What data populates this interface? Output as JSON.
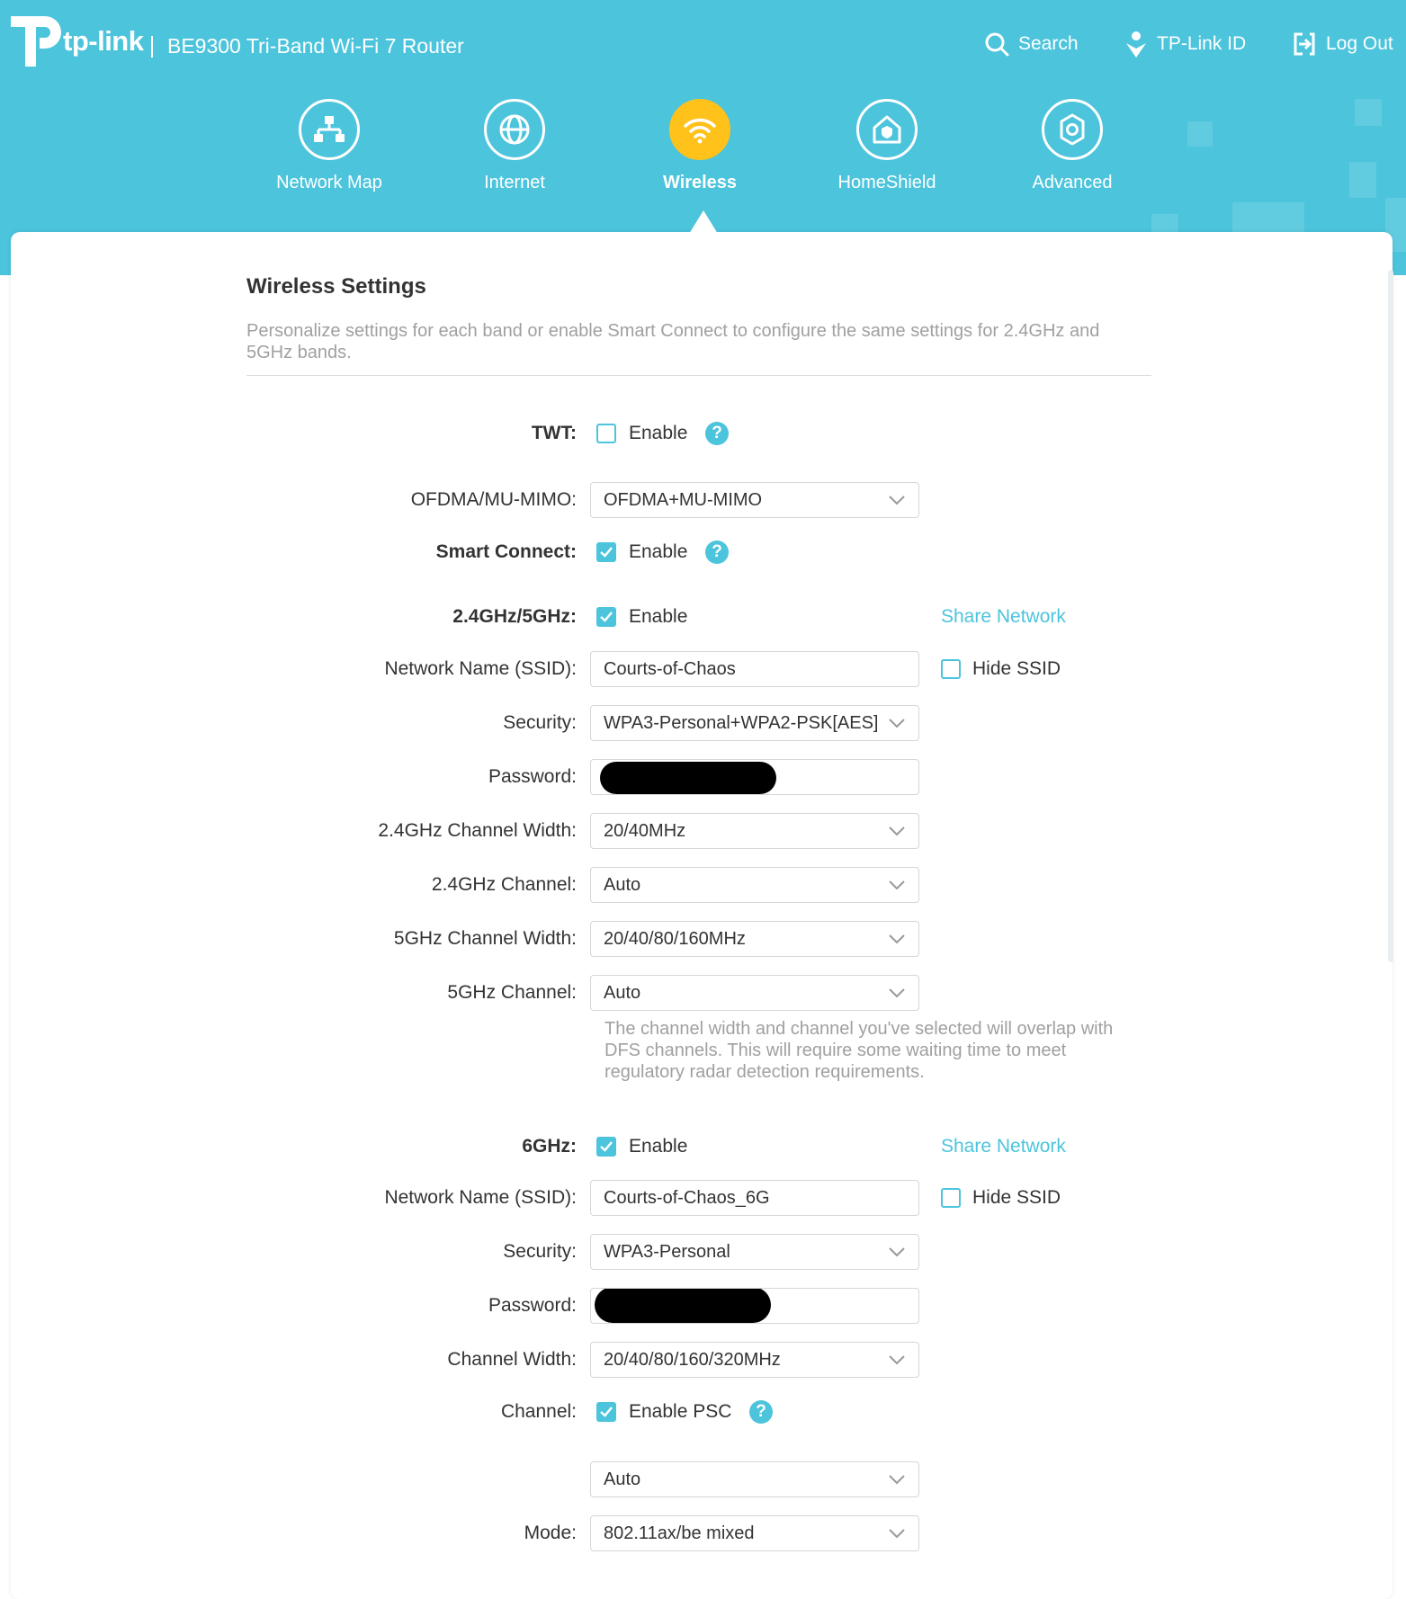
{
  "header": {
    "brand": "tp-link",
    "model": "BE9300 Tri-Band Wi-Fi 7 Router",
    "links": {
      "search": "Search",
      "tplink_id": "TP-Link ID",
      "logout": "Log Out"
    }
  },
  "nav": {
    "items": [
      {
        "label": "Network Map",
        "icon": "network-map-icon"
      },
      {
        "label": "Internet",
        "icon": "globe-icon"
      },
      {
        "label": "Wireless",
        "icon": "wifi-icon",
        "active": true
      },
      {
        "label": "HomeShield",
        "icon": "home-shield-icon"
      },
      {
        "label": "Advanced",
        "icon": "gear-icon"
      }
    ]
  },
  "section": {
    "title": "Wireless Settings",
    "description": "Personalize settings for each band or enable Smart Connect to configure the same settings for 2.4GHz and 5GHz bands."
  },
  "form": {
    "twt": {
      "label": "TWT:",
      "enable_label": "Enable",
      "checked": false
    },
    "ofdma": {
      "label": "OFDMA/MU-MIMO:",
      "value": "OFDMA+MU-MIMO"
    },
    "smart_connect": {
      "label": "Smart Connect:",
      "enable_label": "Enable",
      "checked": true
    },
    "band_24_5": {
      "label": "2.4GHz/5GHz:",
      "enable_label": "Enable",
      "checked": true,
      "share_network": "Share Network",
      "ssid_label": "Network Name (SSID):",
      "ssid": "Courts-of-Chaos",
      "hide_ssid": "Hide SSID",
      "security_label": "Security:",
      "security": "WPA3-Personal+WPA2-PSK[AES]",
      "password_label": "Password:",
      "ch_width_24_label": "2.4GHz Channel Width:",
      "ch_width_24": "20/40MHz",
      "channel_24_label": "2.4GHz Channel:",
      "channel_24": "Auto",
      "ch_width_5_label": "5GHz Channel Width:",
      "ch_width_5": "20/40/80/160MHz",
      "channel_5_label": "5GHz Channel:",
      "channel_5": "Auto",
      "dfs_note": "The channel width and channel you've selected will overlap with DFS channels. This will require some waiting time to meet regulatory radar detection requirements."
    },
    "band_6": {
      "label": "6GHz:",
      "enable_label": "Enable",
      "checked": true,
      "share_network": "Share Network",
      "ssid_label": "Network Name (SSID):",
      "ssid": "Courts-of-Chaos_6G",
      "hide_ssid": "Hide SSID",
      "security_label": "Security:",
      "security": "WPA3-Personal",
      "password_label": "Password:",
      "ch_width_label": "Channel Width:",
      "ch_width": "20/40/80/160/320MHz",
      "channel_label": "Channel:",
      "psc_label": "Enable PSC",
      "psc_checked": true,
      "channel": "Auto",
      "mode_label": "Mode:",
      "mode": "802.11ax/be mixed"
    }
  },
  "colors": {
    "accent": "#4cc4dc",
    "active_nav": "#ffc21a",
    "text": "#333333",
    "muted": "#a0a0a0"
  }
}
